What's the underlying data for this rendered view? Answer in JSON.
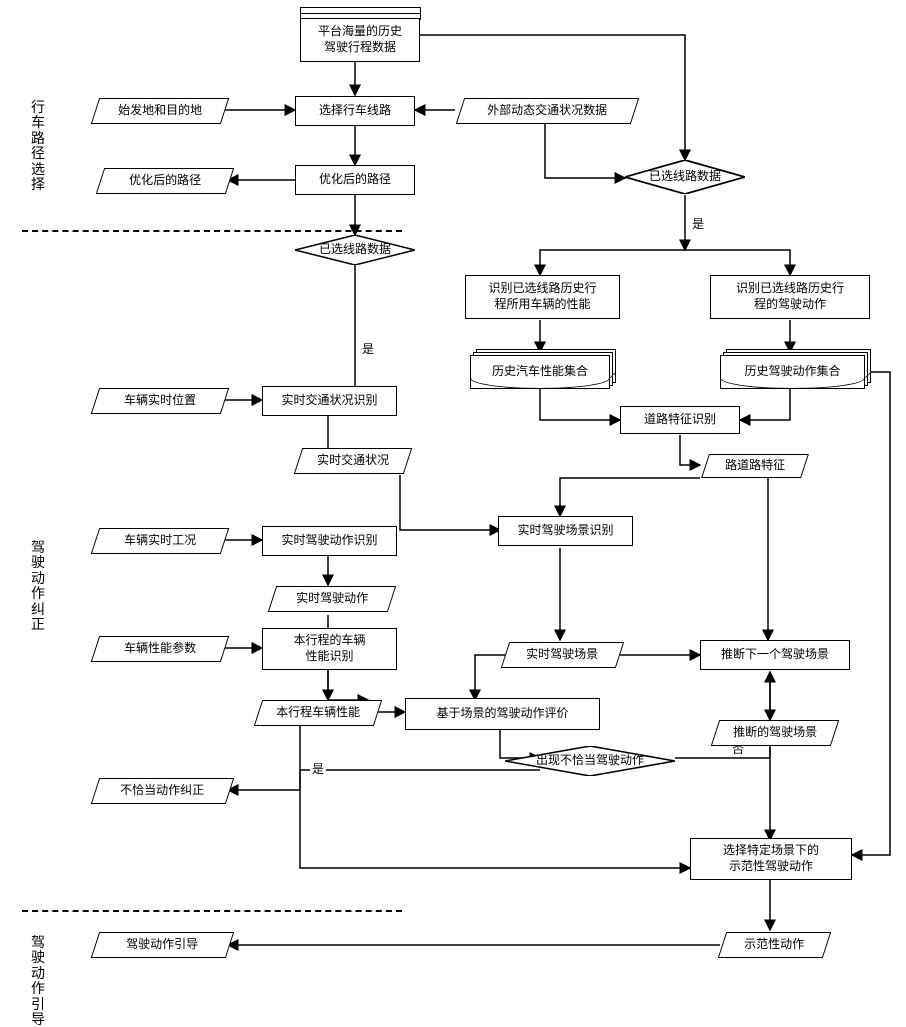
{
  "stages": {
    "s1": "行车路径选择",
    "s2": "驾驶动作纠正",
    "s3": "驾驶动作引导"
  },
  "nodes": {
    "n_hist": "平台海量的历史\n驾驶行程数据",
    "n_origin": "始发地和目的地",
    "n_select_route": "选择行车线路",
    "n_ext_traffic": "外部动态交通状况数据",
    "n_opt_route_out": "优化后的路径",
    "n_opt_route_proc": "优化后的路径",
    "n_route_data1": "已选线路数据",
    "n_route_data2": "已选线路数据",
    "n_rec_vehicle_perf": "识别已选线路历史行\n程所用车辆的性能",
    "n_rec_drive_action": "识别已选线路历史行\n程的驾驶动作",
    "n_hist_vehicle_set": "历史汽车性能集合",
    "n_hist_action_set": "历史驾驶动作集合",
    "n_vehicle_pos": "车辆实时位置",
    "n_rt_traffic_rec": "实时交通状况识别",
    "n_rt_traffic": "实时交通状况",
    "n_road_feat_rec": "道路特征识别",
    "n_road_feat": "路道路特征",
    "n_vehicle_cond": "车辆实时工况",
    "n_rt_action_rec": "实时驾驶动作识别",
    "n_rt_action": "实时驾驶动作",
    "n_rt_scene_rec": "实时驾驶场景识别",
    "n_rt_scene": "实时驾驶场景",
    "n_next_scene": "推断下一个驾驶场景",
    "n_vehicle_param": "车辆性能参数",
    "n_trip_perf_rec": "本行程的车辆\n性能识别",
    "n_trip_perf": "本行程车辆性能",
    "n_scene_eval": "基于场景的驾驶动作评价",
    "n_inferred_scene": "推断的驾驶场景",
    "n_improper_out": "不恰当动作纠正",
    "n_improper_dec": "出现不恰当驾驶动作",
    "n_select_demo": "选择特定场景下的\n示范性驾驶动作",
    "n_demo_action": "示范性动作",
    "n_guide_out": "驾驶动作引导"
  },
  "labels": {
    "yes": "是",
    "no": "否"
  },
  "chart_data": {
    "type": "flowchart",
    "title": "",
    "stages": [
      {
        "id": "s1",
        "label": "行车路径选择"
      },
      {
        "id": "s2",
        "label": "驾驶动作纠正"
      },
      {
        "id": "s3",
        "label": "驾驶动作引导"
      }
    ],
    "nodes": [
      {
        "id": "n_hist",
        "type": "datasource",
        "label": "平台海量的历史驾驶行程数据"
      },
      {
        "id": "n_origin",
        "type": "io",
        "label": "始发地和目的地"
      },
      {
        "id": "n_select_route",
        "type": "process",
        "label": "选择行车线路"
      },
      {
        "id": "n_ext_traffic",
        "type": "io",
        "label": "外部动态交通状况数据"
      },
      {
        "id": "n_opt_route_out",
        "type": "io",
        "label": "优化后的路径"
      },
      {
        "id": "n_opt_route_proc",
        "type": "process",
        "label": "优化后的路径"
      },
      {
        "id": "n_route_data1",
        "type": "decision",
        "label": "已选线路数据"
      },
      {
        "id": "n_route_data2",
        "type": "decision",
        "label": "已选线路数据"
      },
      {
        "id": "n_rec_vehicle_perf",
        "type": "process",
        "label": "识别已选线路历史行程所用车辆的性能"
      },
      {
        "id": "n_rec_drive_action",
        "type": "process",
        "label": "识别已选线路历史行程的驾驶动作"
      },
      {
        "id": "n_hist_vehicle_set",
        "type": "document-stack",
        "label": "历史汽车性能集合"
      },
      {
        "id": "n_hist_action_set",
        "type": "document-stack",
        "label": "历史驾驶动作集合"
      },
      {
        "id": "n_vehicle_pos",
        "type": "io",
        "label": "车辆实时位置"
      },
      {
        "id": "n_rt_traffic_rec",
        "type": "process",
        "label": "实时交通状况识别"
      },
      {
        "id": "n_rt_traffic",
        "type": "io",
        "label": "实时交通状况"
      },
      {
        "id": "n_road_feat_rec",
        "type": "process",
        "label": "道路特征识别"
      },
      {
        "id": "n_road_feat",
        "type": "io",
        "label": "路道路特征"
      },
      {
        "id": "n_vehicle_cond",
        "type": "io",
        "label": "车辆实时工况"
      },
      {
        "id": "n_rt_action_rec",
        "type": "process",
        "label": "实时驾驶动作识别"
      },
      {
        "id": "n_rt_action",
        "type": "io",
        "label": "实时驾驶动作"
      },
      {
        "id": "n_rt_scene_rec",
        "type": "process",
        "label": "实时驾驶场景识别"
      },
      {
        "id": "n_rt_scene",
        "type": "io",
        "label": "实时驾驶场景"
      },
      {
        "id": "n_next_scene",
        "type": "process",
        "label": "推断下一个驾驶场景"
      },
      {
        "id": "n_vehicle_param",
        "type": "io",
        "label": "车辆性能参数"
      },
      {
        "id": "n_trip_perf_rec",
        "type": "process",
        "label": "本行程的车辆性能识别"
      },
      {
        "id": "n_trip_perf",
        "type": "io",
        "label": "本行程车辆性能"
      },
      {
        "id": "n_scene_eval",
        "type": "process",
        "label": "基于场景的驾驶动作评价"
      },
      {
        "id": "n_inferred_scene",
        "type": "io",
        "label": "推断的驾驶场景"
      },
      {
        "id": "n_improper_out",
        "type": "io",
        "label": "不恰当动作纠正"
      },
      {
        "id": "n_improper_dec",
        "type": "decision",
        "label": "出现不恰当驾驶动作"
      },
      {
        "id": "n_select_demo",
        "type": "process",
        "label": "选择特定场景下的示范性驾驶动作"
      },
      {
        "id": "n_demo_action",
        "type": "io",
        "label": "示范性动作"
      },
      {
        "id": "n_guide_out",
        "type": "io",
        "label": "驾驶动作引导"
      }
    ],
    "edges": [
      {
        "from": "n_hist",
        "to": "n_select_route"
      },
      {
        "from": "n_origin",
        "to": "n_select_route"
      },
      {
        "from": "n_ext_traffic",
        "to": "n_select_route"
      },
      {
        "from": "n_select_route",
        "to": "n_opt_route_proc"
      },
      {
        "from": "n_opt_route_proc",
        "to": "n_opt_route_out"
      },
      {
        "from": "n_opt_route_proc",
        "to": "n_route_data1"
      },
      {
        "from": "n_hist",
        "to": "n_route_data2"
      },
      {
        "from": "n_ext_traffic",
        "to": "n_route_data2"
      },
      {
        "from": "n_route_data2",
        "to": "n_rec_vehicle_perf",
        "label": "是"
      },
      {
        "from": "n_route_data2",
        "to": "n_rec_drive_action",
        "label": "是"
      },
      {
        "from": "n_rec_vehicle_perf",
        "to": "n_hist_vehicle_set"
      },
      {
        "from": "n_rec_drive_action",
        "to": "n_hist_action_set"
      },
      {
        "from": "n_route_data1",
        "to": "n_rt_traffic_rec",
        "label": "是"
      },
      {
        "from": "n_vehicle_pos",
        "to": "n_rt_traffic_rec"
      },
      {
        "from": "n_rt_traffic_rec",
        "to": "n_rt_traffic"
      },
      {
        "from": "n_hist_vehicle_set",
        "to": "n_road_feat_rec"
      },
      {
        "from": "n_hist_action_set",
        "to": "n_road_feat_rec"
      },
      {
        "from": "n_road_feat_rec",
        "to": "n_road_feat"
      },
      {
        "from": "n_rt_traffic",
        "to": "n_rt_scene_rec"
      },
      {
        "from": "n_road_feat",
        "to": "n_rt_scene_rec"
      },
      {
        "from": "n_vehicle_cond",
        "to": "n_rt_action_rec"
      },
      {
        "from": "n_rt_action_rec",
        "to": "n_rt_action"
      },
      {
        "from": "n_rt_scene_rec",
        "to": "n_rt_scene"
      },
      {
        "from": "n_rt_scene",
        "to": "n_scene_eval"
      },
      {
        "from": "n_rt_action",
        "to": "n_scene_eval"
      },
      {
        "from": "n_rt_scene",
        "to": "n_next_scene"
      },
      {
        "from": "n_road_feat",
        "to": "n_next_scene"
      },
      {
        "from": "n_vehicle_param",
        "to": "n_trip_perf_rec"
      },
      {
        "from": "n_trip_perf_rec",
        "to": "n_trip_perf"
      },
      {
        "from": "n_trip_perf",
        "to": "n_scene_eval"
      },
      {
        "from": "n_scene_eval",
        "to": "n_improper_dec"
      },
      {
        "from": "n_improper_dec",
        "to": "n_improper_out",
        "label": "是"
      },
      {
        "from": "n_improper_dec",
        "to": "n_next_scene",
        "label": "否"
      },
      {
        "from": "n_next_scene",
        "to": "n_inferred_scene"
      },
      {
        "from": "n_inferred_scene",
        "to": "n_select_demo"
      },
      {
        "from": "n_trip_perf",
        "to": "n_select_demo"
      },
      {
        "from": "n_hist_action_set",
        "to": "n_select_demo"
      },
      {
        "from": "n_select_demo",
        "to": "n_demo_action"
      },
      {
        "from": "n_demo_action",
        "to": "n_guide_out"
      }
    ]
  }
}
